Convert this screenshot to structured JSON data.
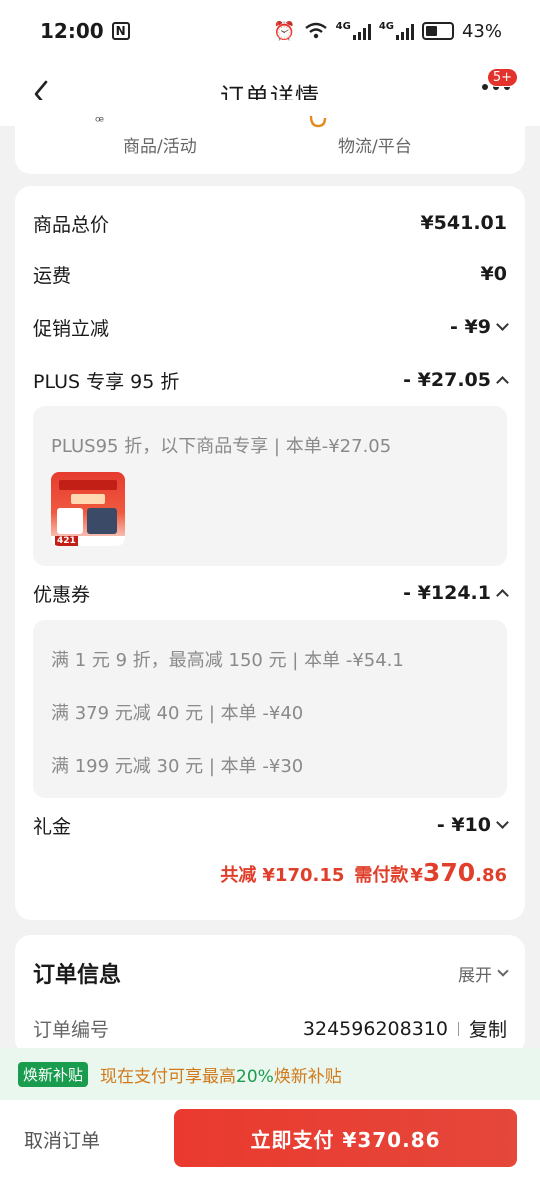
{
  "status": {
    "time": "12:00",
    "nfc": "N",
    "net1": "4G",
    "net2": "4G",
    "battery": "43%"
  },
  "nav": {
    "title": "订单详情",
    "badge": "5+"
  },
  "top_card": {
    "left_label": "商品/活动",
    "right_label": "物流/平台"
  },
  "price": {
    "goods_total_label": "商品总价",
    "goods_total": "¥541.01",
    "shipping_label": "运费",
    "shipping": "¥0",
    "promo_label": "促销立减",
    "promo": "- ¥9",
    "plus_label": "PLUS 专享 95 折",
    "plus": "- ¥27.05",
    "plus_detail": "PLUS95 折，以下商品专享 | 本单-¥27.05",
    "thumb_number": "421",
    "coupon_label": "优惠券",
    "coupon": "- ¥124.1",
    "coupon_details": [
      "满 1 元 9 折，最高减 150 元 | 本单 -¥54.1",
      "满 379 元减 40 元 | 本单 -¥40",
      "满 199 元减 30 元 | 本单 -¥30"
    ],
    "gift_label": "礼金",
    "gift": "- ¥10",
    "total_reduce_label": "共减",
    "total_reduce": "¥170.15",
    "need_pay_label": "需付款",
    "need_pay_symbol": "¥",
    "need_pay_int": "370",
    "need_pay_dec": ".86"
  },
  "order_info": {
    "title": "订单信息",
    "expand": "展开",
    "number_label": "订单编号",
    "number": "324596208310",
    "copy": "复制"
  },
  "subsidy": {
    "tag": "焕新补贴",
    "text_a": "现在支付可享最高",
    "pct": "20%",
    "text_b": "焕新补贴"
  },
  "bottom": {
    "cancel": "取消订单",
    "pay": "立即支付 ¥370.86"
  },
  "colors": {
    "accent_red": "#e0402b",
    "button_red": "#ea3a2f",
    "green": "#1a9c4e",
    "orange": "#d27a1b"
  }
}
